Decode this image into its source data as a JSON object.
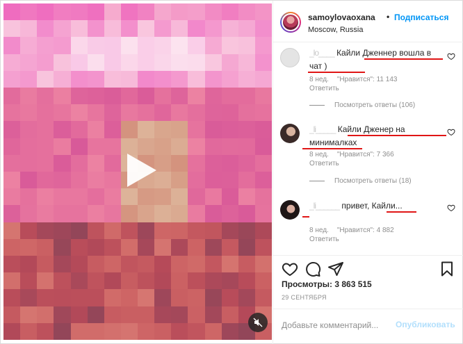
{
  "post": {
    "username": "samoylovaoxana",
    "separator": "•",
    "follow_label": "Подписаться",
    "location": "Moscow, Russia"
  },
  "comments": [
    {
      "user": "_lo____",
      "text": "Кайли Дженнер вошла в чат )",
      "age": "8 нед.",
      "likes": "\"Нравится\": 11 143",
      "reply": "Ответить",
      "view_replies": "Посмотреть ответы (106)"
    },
    {
      "user": "_li_____",
      "text": "Кайли Дженер на минималках",
      "age": "8 нед.",
      "likes": "\"Нравится\": 7 366",
      "reply": "Ответить",
      "view_replies": "Посмотреть ответы (18)"
    },
    {
      "user": "_li______",
      "text": "привет, Кайли...",
      "age": "8 нед.",
      "likes": "\"Нравится\": 4 882",
      "reply": "Ответить"
    }
  ],
  "stats": {
    "views": "Просмотры: 3 863 515",
    "date": "29 СЕНТЯБРЯ"
  },
  "composer": {
    "placeholder": "Добавьте комментарий...",
    "publish_label": "Опубликовать"
  },
  "colors": {
    "accent": "#0095f6",
    "publish_disabled": "#b2dffc",
    "annotation": "#e01515",
    "video_tint": "#d9668f"
  },
  "icons": [
    "play-icon",
    "mute-icon",
    "heart-icon",
    "comment-icon",
    "share-icon",
    "bookmark-icon"
  ]
}
